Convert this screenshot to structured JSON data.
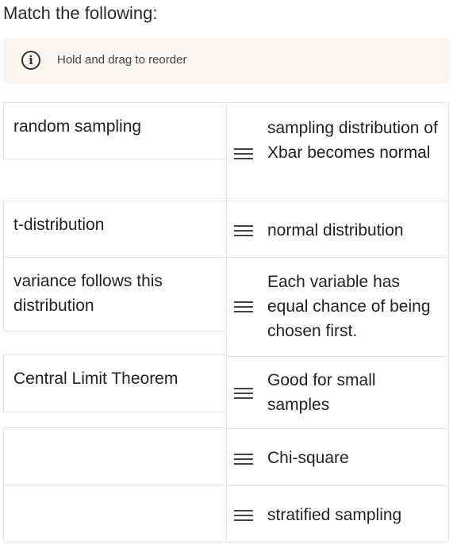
{
  "header": {
    "title": "Match the following:"
  },
  "hint": {
    "icon": "info-icon",
    "icon_glyph": "i",
    "text": "Hold and drag to reorder"
  },
  "left_items": [
    {
      "label": "random sampling"
    },
    {
      "label": "t-distribution"
    },
    {
      "label": "variance follows this distribution"
    },
    {
      "label": "Central Limit Theorem"
    },
    {
      "label": ""
    },
    {
      "label": ""
    }
  ],
  "right_items": [
    {
      "label": "sampling distribution of Xbar becomes normal"
    },
    {
      "label": "normal distribution"
    },
    {
      "label": "Each variable has equal chance of being chosen first."
    },
    {
      "label": "Good for small samples"
    },
    {
      "label": "Chi-square"
    },
    {
      "label": "stratified sampling"
    }
  ],
  "drag_handle_icon": "drag-handle-icon"
}
